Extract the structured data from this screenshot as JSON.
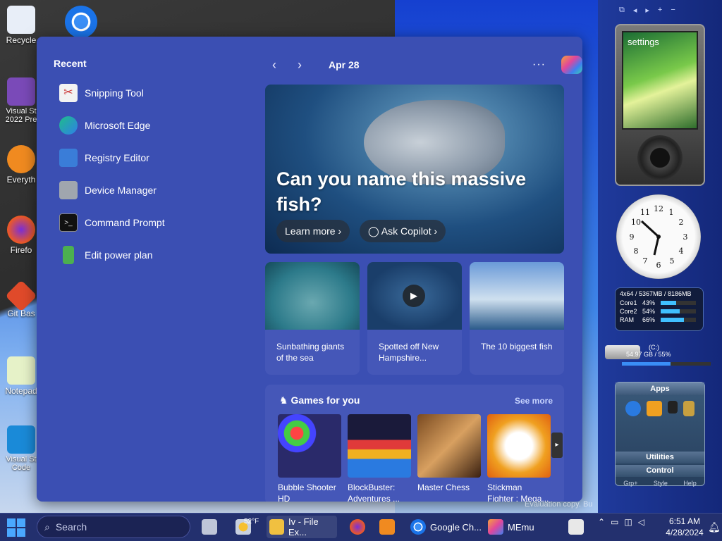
{
  "desktop": {
    "icons": [
      {
        "label": "Recycle",
        "name": "recycle-bin-icon"
      },
      {
        "label": "Visual St\n2022 Pre",
        "name": "visual-studio-2022-icon"
      },
      {
        "label": "Everyth",
        "name": "everything-icon"
      },
      {
        "label": "Firefo",
        "name": "firefox-icon"
      },
      {
        "label": "Git Bas",
        "name": "git-bash-icon"
      },
      {
        "label": "Notepad",
        "name": "notepad-icon"
      },
      {
        "label": "Visual St\nCode",
        "name": "vscode-icon"
      }
    ],
    "watermark": "Evaluation copy. Bu"
  },
  "start": {
    "recent_title": "Recent",
    "recent": [
      {
        "label": "Snipping Tool",
        "icon": "snipping-tool-icon",
        "color": "#e8e8e8"
      },
      {
        "label": "Microsoft Edge",
        "icon": "edge-icon",
        "color": "#2fa7e8"
      },
      {
        "label": "Registry Editor",
        "icon": "registry-editor-icon",
        "color": "#3a7dd8"
      },
      {
        "label": "Device Manager",
        "icon": "device-manager-icon",
        "color": "#9aa0a8"
      },
      {
        "label": "Command Prompt",
        "icon": "command-prompt-icon",
        "color": "#1a1a1a"
      },
      {
        "label": "Edit power plan",
        "icon": "power-plan-icon",
        "color": "#4cb050"
      }
    ],
    "feed": {
      "prev_label": "‹",
      "next_label": "›",
      "date": "Apr 28",
      "more_label": "···",
      "hero_title": "Can you name this massive fish?",
      "learn_more": "Learn more ›",
      "ask_copilot": "Ask Copilot ›",
      "tiles": [
        {
          "caption": "Sunbathing giants of the sea"
        },
        {
          "caption": "Spotted off New Hampshire..."
        },
        {
          "caption": "The 10 biggest fish"
        }
      ],
      "games_title": "Games for you",
      "see_more": "See more",
      "games": [
        {
          "title": "Bubble Shooter HD"
        },
        {
          "title": "BlockBuster: Adventures ..."
        },
        {
          "title": "Master Chess"
        },
        {
          "title": "Stickman Fighter : Mega..."
        }
      ]
    }
  },
  "gadgets": {
    "zune_label": "settings",
    "cpu_header": "4x64 / 5367MB / 8186MB",
    "cpu_rows": [
      {
        "name": "Core1",
        "value": "43%",
        "fraction": 0.43
      },
      {
        "name": "Core2",
        "value": "54%",
        "fraction": 0.54
      },
      {
        "name": "RAM",
        "value": "66%",
        "fraction": 0.66
      }
    ],
    "drive_label": "(C:)",
    "drive_info": "54.97 GB / 55%",
    "drive_fraction": 0.55,
    "apps_title": "Apps",
    "apps_utilities": "Utilities",
    "apps_control": "Control",
    "apps_footer": [
      "Grp+",
      "Style",
      "Help"
    ]
  },
  "taskbar": {
    "search_placeholder": "Search",
    "weather": "52°F",
    "items": [
      {
        "label": "Iv - File Ex...",
        "icon": "file-explorer-icon"
      },
      {
        "label": "Google Ch...",
        "icon": "chrome-icon"
      },
      {
        "label": "MEmu",
        "icon": "memu-icon"
      }
    ],
    "time": "6:51 AM",
    "date": "4/28/2024"
  }
}
